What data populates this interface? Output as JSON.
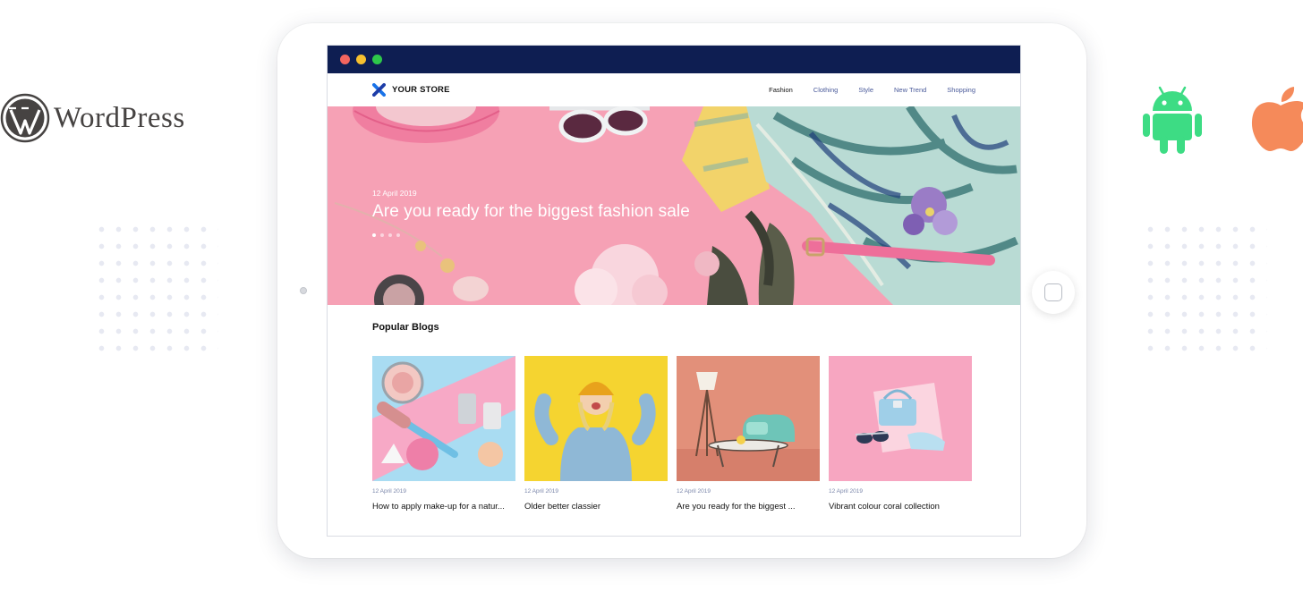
{
  "left_brand": {
    "wordmark": "WordPress",
    "icon": "wordpress-icon"
  },
  "right_platforms": [
    {
      "name": "android-icon",
      "color": "#3ddc84"
    },
    {
      "name": "apple-icon",
      "color": "#f58a5a"
    }
  ],
  "window": {
    "traffic_lights": [
      "#f4655f",
      "#f7c02f",
      "#2ec84a"
    ]
  },
  "store": {
    "brand": "YOUR STORE",
    "nav": [
      "Fashion",
      "Clothing",
      "Style",
      "New Trend",
      "Shopping"
    ],
    "active_nav": "Fashion"
  },
  "hero": {
    "date": "12 April 2019",
    "title": "Are you ready for the biggest fashion sale",
    "slides": 4,
    "active_slide": 1
  },
  "popular": {
    "heading": "Popular Blogs",
    "posts": [
      {
        "date": "12 April 2019",
        "title": "How to apply make-up for a natur..."
      },
      {
        "date": "12 April 2019",
        "title": "Older better classier"
      },
      {
        "date": "12 April 2019",
        "title": "Are you ready for the biggest ..."
      },
      {
        "date": "12 April 2019",
        "title": "Vibrant colour coral collection"
      }
    ]
  }
}
